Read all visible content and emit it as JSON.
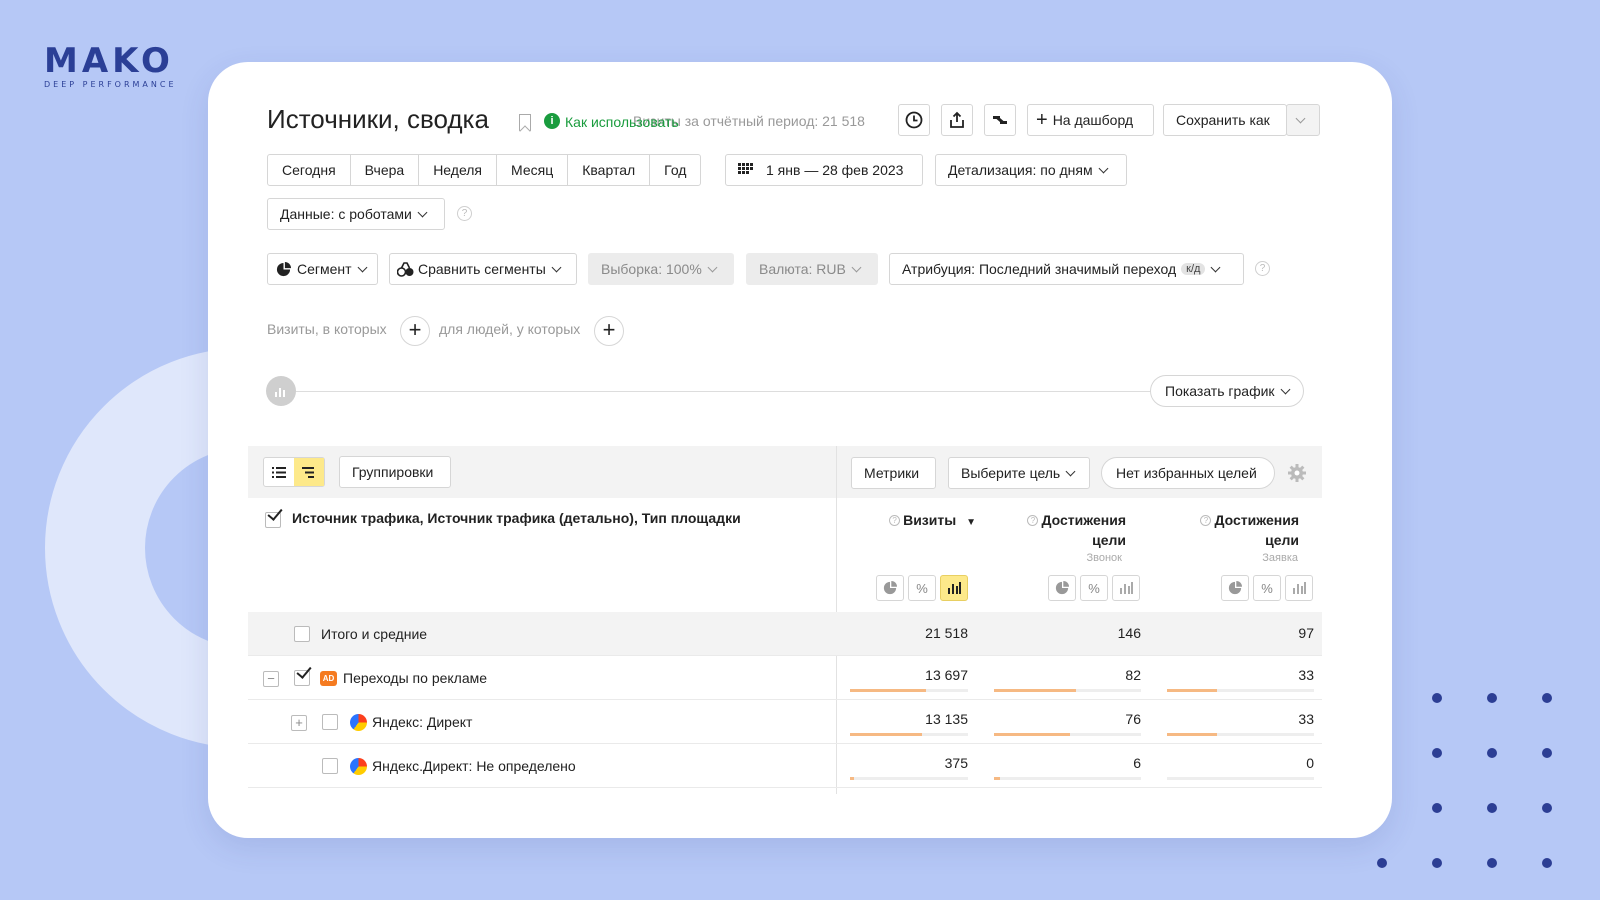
{
  "logo": {
    "name": "MAKO",
    "tagline": "DEEP PERFORMANCE"
  },
  "colors": {
    "background": "#b6c8f6",
    "accent_green": "#1a9c3e",
    "accent_yellow": "#fde98a",
    "bar_orange": "#f6b983",
    "logo_blue": "#2b3f96"
  },
  "report": {
    "title": "Источники, сводка",
    "how_to_use": "Как использовать",
    "total_visits_label": "Визиты за отчётный период: 21 518"
  },
  "header_buttons": {
    "history_icon": "clock-icon",
    "export_icon": "export-icon",
    "compare_icon": "compare-icon",
    "dashboard": "На дашборд",
    "save_as": "Сохранить как"
  },
  "periods": [
    "Сегодня",
    "Вчера",
    "Неделя",
    "Месяц",
    "Квартал",
    "Год"
  ],
  "date_range": "1 янв — 28 фев 2023",
  "detail": "Детализация: по дням",
  "data_mode": "Данные: с роботами",
  "filters": {
    "segment": "Сегмент",
    "compare_segments": "Сравнить сегменты",
    "sample": "Выборка: 100%",
    "currency": "Валюта: RUB",
    "attribution": "Атрибуция: Последний значимый переход",
    "attribution_badge": "к/д"
  },
  "conditions": {
    "visits_where": "Визиты, в которых",
    "people_where": "для людей, у которых"
  },
  "show_chart": "Показать график",
  "table_toolbar": {
    "groupings": "Группировки",
    "metrics": "Метрики",
    "choose_goal": "Выберите цель",
    "no_favorite_goals": "Нет избранных целей"
  },
  "table": {
    "dimension_header": "Источник трафика, Источник трафика (детально), Тип площадки",
    "columns": [
      {
        "title": "Визиты",
        "sub": "",
        "sort": "▼"
      },
      {
        "title_line1": "Достижения",
        "title_line2": "цели",
        "sub": "Звонок"
      },
      {
        "title_line1": "Достижения",
        "title_line2": "цели",
        "sub": "Заявка"
      }
    ],
    "rows": [
      {
        "label": "Итого и средние",
        "values": [
          "21 518",
          "146",
          "97"
        ],
        "bars": [
          null,
          null,
          null
        ]
      },
      {
        "label": "Переходы по рекламе",
        "values": [
          "13 697",
          "82",
          "33"
        ],
        "bars": [
          0.64,
          0.56,
          0.34
        ]
      },
      {
        "label": "Яндекс: Директ",
        "values": [
          "13 135",
          "76",
          "33"
        ],
        "bars": [
          0.61,
          0.52,
          0.34
        ]
      },
      {
        "label": "Яндекс.Директ: Не определено",
        "values": [
          "375",
          "6",
          "0"
        ],
        "bars": [
          0.02,
          0.04,
          0
        ]
      }
    ]
  }
}
